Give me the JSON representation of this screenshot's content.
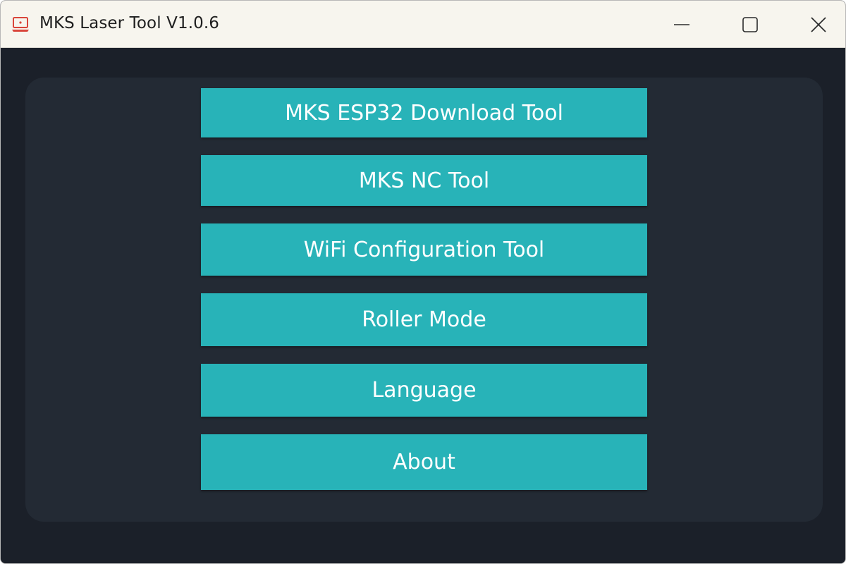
{
  "window": {
    "title": "MKS Laser Tool V1.0.6",
    "icon": "laptop-icon",
    "controls": [
      "minimize-icon",
      "maximize-icon",
      "close-icon"
    ]
  },
  "menu": {
    "items": [
      {
        "label": "MKS ESP32 Download Tool"
      },
      {
        "label": "MKS NC Tool"
      },
      {
        "label": "WiFi Configuration Tool"
      },
      {
        "label": "Roller Mode"
      },
      {
        "label": "Language"
      },
      {
        "label": "About"
      }
    ]
  },
  "colors": {
    "titlebar": "#f7f5ee",
    "background": "#1b2029",
    "panel": "#232a34",
    "button": "#28b3b8",
    "button_text": "#ffffff",
    "icon_red": "#d9453b"
  }
}
